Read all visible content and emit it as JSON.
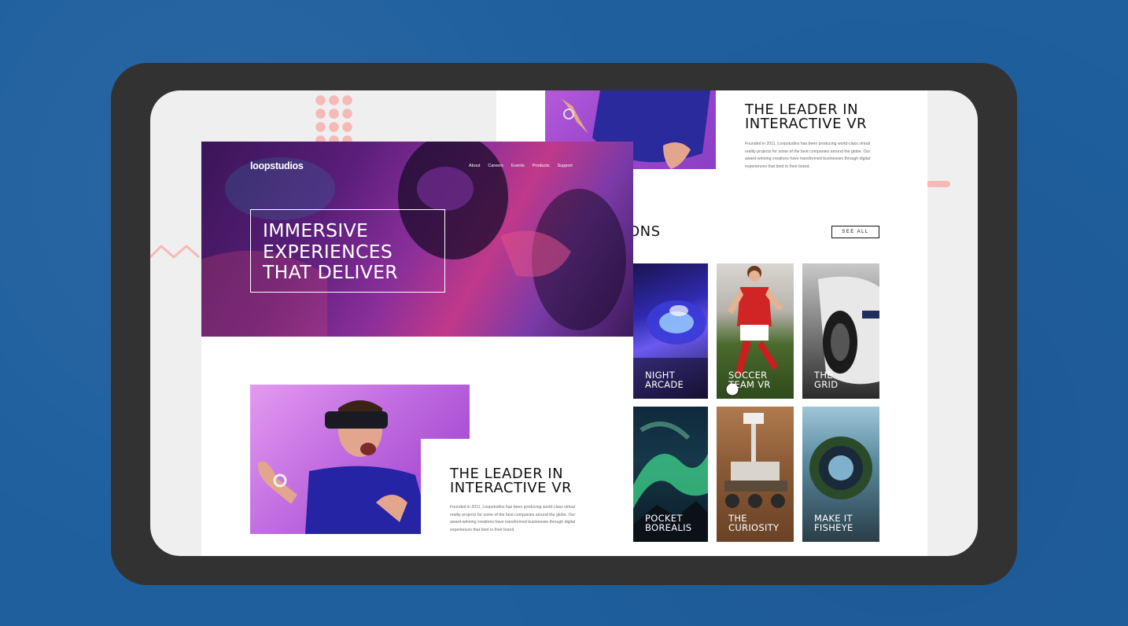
{
  "brand": {
    "logo": "loopstudios"
  },
  "nav": {
    "items": [
      "About",
      "Careers",
      "Events",
      "Products",
      "Support"
    ]
  },
  "hero": {
    "headline_lines": [
      "IMMERSIVE",
      "EXPERIENCES",
      "THAT DELIVER"
    ]
  },
  "leader": {
    "title_lines": [
      "THE LEADER IN",
      "INTERACTIVE VR"
    ],
    "copy": "Founded in 2011, Loopstudios has been producing world-class virtual reality projects for some of the best companies around the globe. Our award-winning creations have transformed businesses through digital experiences that bind to their brand."
  },
  "creations": {
    "title_fragment": "ONS",
    "see_all_label": "SEE ALL",
    "cards": [
      {
        "label_lines": [
          "NIGHT",
          "ARCADE"
        ]
      },
      {
        "label_lines": [
          "SOCCER",
          "TEAM VR"
        ]
      },
      {
        "label_lines": [
          "THE",
          "GRID"
        ]
      },
      {
        "label_lines": [
          "POCKET",
          "BOREALIS"
        ]
      },
      {
        "label_lines": [
          "THE",
          "CURIOSITY"
        ]
      },
      {
        "label_lines": [
          "MAKE IT",
          "FISHEYE"
        ]
      }
    ]
  },
  "colors": {
    "background": "#1f5f9e",
    "tablet_frame": "#323232",
    "accent_pink": "#f6b9b7",
    "hero_purple": "#8a2f9a"
  }
}
